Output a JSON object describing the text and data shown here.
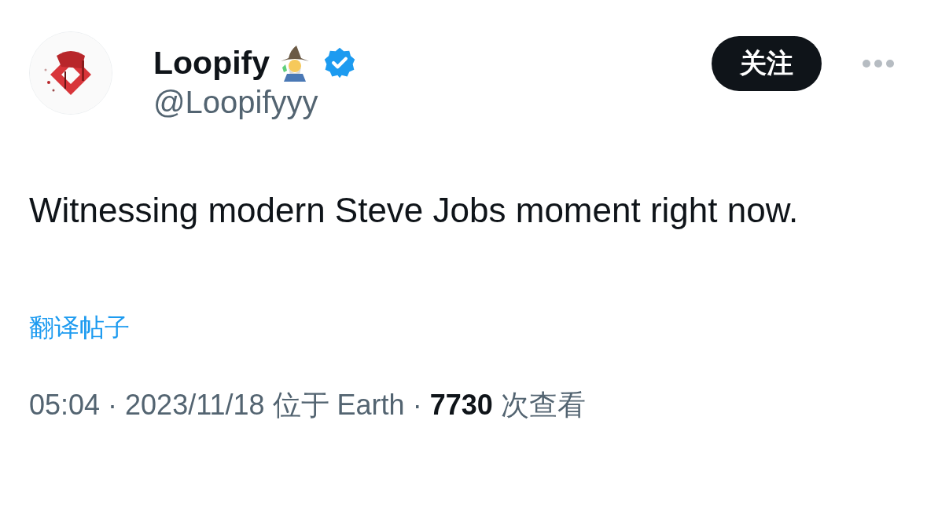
{
  "author": {
    "display_name": "Loopify",
    "handle": "@Loopifyyy",
    "verified": true
  },
  "follow_button": {
    "label": "关注"
  },
  "tweet": {
    "text": "Witnessing modern Steve Jobs moment right now.",
    "translate_link": "翻译帖子",
    "meta": "05:04 · 2023/11/18 位于 Earth · **7730** 次查看"
  }
}
